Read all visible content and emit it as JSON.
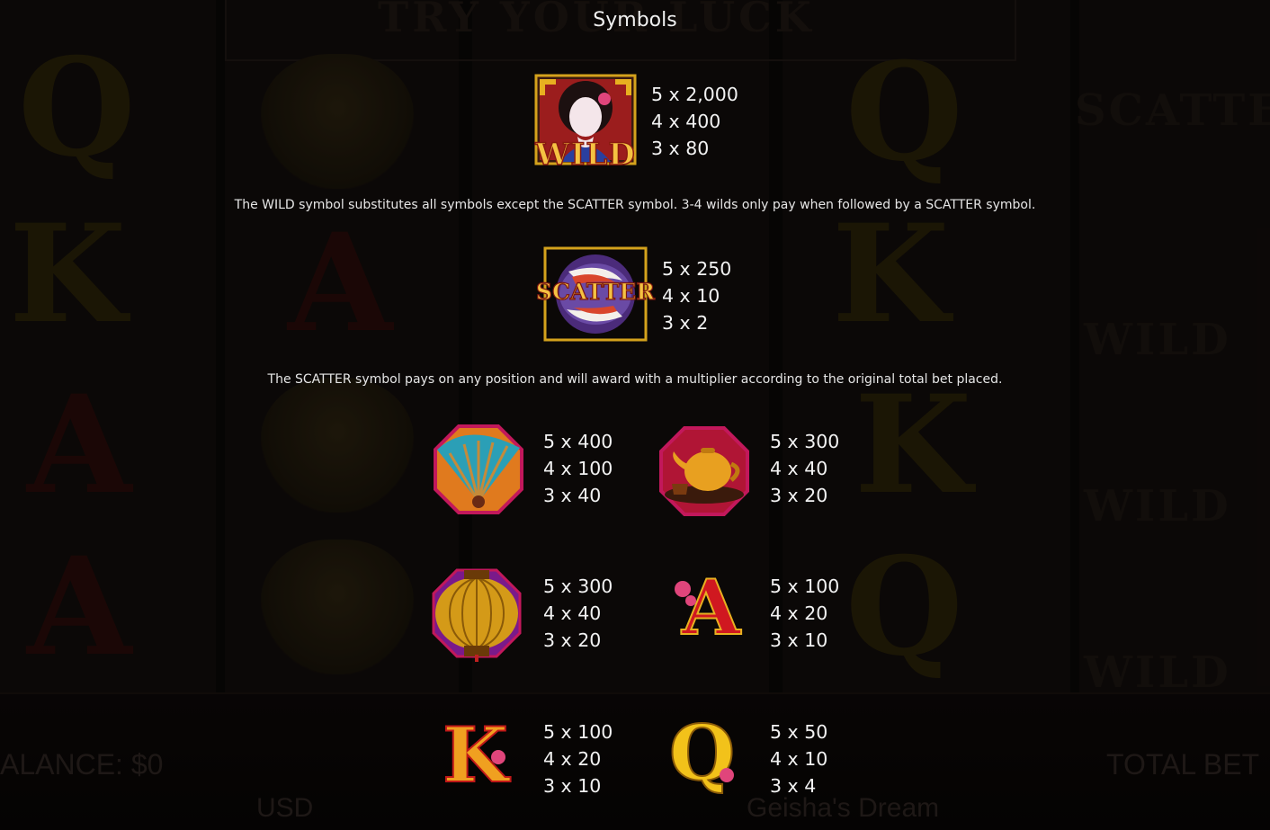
{
  "title": "Symbols",
  "background": {
    "game_title": "TRY YOUR LUCK",
    "balance_label": "ALANCE: $0",
    "currency": "USD",
    "game_name": "Geisha's Dream",
    "total_bet_label": "TOTAL BET",
    "scatter_word": "SCATTER",
    "wild_word": "WILD"
  },
  "symbols": {
    "wild": {
      "label": "WILD",
      "pays": [
        "5 x 2,000",
        "4 x 400",
        "3 x 80"
      ]
    },
    "scatter": {
      "label": "SCATTER",
      "pays": [
        "5 x 250",
        "4 x 10",
        "3 x 2"
      ]
    },
    "fan": {
      "pays": [
        "5 x 400",
        "4 x 100",
        "3 x 40"
      ]
    },
    "teapot": {
      "pays": [
        "5 x 300",
        "4 x 40",
        "3 x 20"
      ]
    },
    "lantern": {
      "pays": [
        "5 x 300",
        "4 x 40",
        "3 x 20"
      ]
    },
    "letter_a": {
      "letter": "A",
      "pays": [
        "5 x 100",
        "4 x 20",
        "3 x 10"
      ]
    },
    "letter_k": {
      "letter": "K",
      "pays": [
        "5 x 100",
        "4 x 20",
        "3 x 10"
      ]
    },
    "letter_q": {
      "letter": "Q",
      "pays": [
        "5 x 50",
        "4 x 10",
        "3 x 4"
      ]
    }
  },
  "descriptions": {
    "wild": "The WILD symbol substitutes all symbols except the SCATTER symbol. 3-4 wilds only pay when followed by a SCATTER symbol.",
    "scatter": "The SCATTER symbol pays on any position and will award with a multiplier according to the original total bet placed."
  },
  "colors": {
    "text": "#f2f2f2",
    "gold": "#e8b020",
    "red": "#c0141c",
    "magenta": "#c2185b"
  }
}
